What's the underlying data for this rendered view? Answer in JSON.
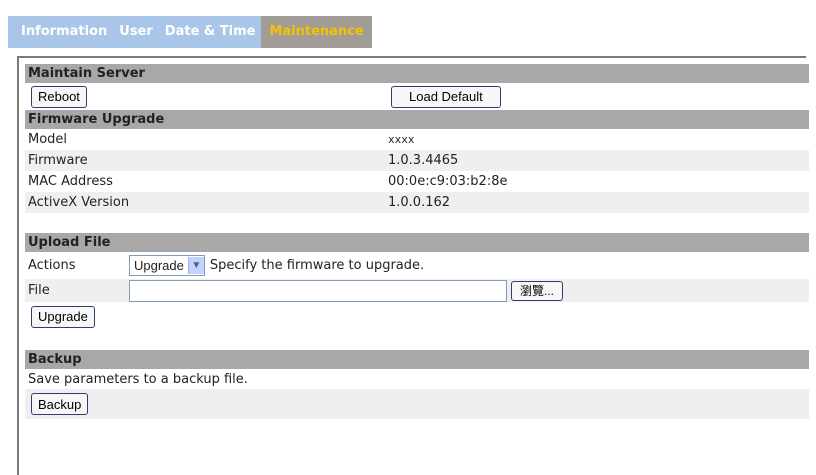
{
  "tabs": [
    {
      "label": "Information"
    },
    {
      "label": "User"
    },
    {
      "label": "Date & Time"
    },
    {
      "label": "Maintenance"
    }
  ],
  "maintain_server": {
    "title": "Maintain Server",
    "reboot_label": "Reboot",
    "load_default_label": "Load Default"
  },
  "firmware_upgrade": {
    "title": "Firmware Upgrade",
    "rows": [
      {
        "label": "Model",
        "value": "xxxx"
      },
      {
        "label": "Firmware",
        "value": "1.0.3.4465"
      },
      {
        "label": "MAC Address",
        "value": "00:0e:c9:03:b2:8e"
      },
      {
        "label": "ActiveX Version",
        "value": "1.0.0.162"
      }
    ]
  },
  "upload_file": {
    "title": "Upload File",
    "actions_label": "Actions",
    "actions_selected": "Upgrade",
    "actions_hint": "Specify the firmware to upgrade.",
    "file_label": "File",
    "file_value": "",
    "browse_label": "瀏覽...",
    "upgrade_label": "Upgrade"
  },
  "backup": {
    "title": "Backup",
    "description": "Save parameters to a backup file.",
    "backup_label": "Backup"
  },
  "colors": {
    "tab_bar": "#a9c6e9",
    "tab_active_bg": "#a29c96",
    "tab_active_text": "#f7c100",
    "section_header": "#a8a8a8"
  }
}
